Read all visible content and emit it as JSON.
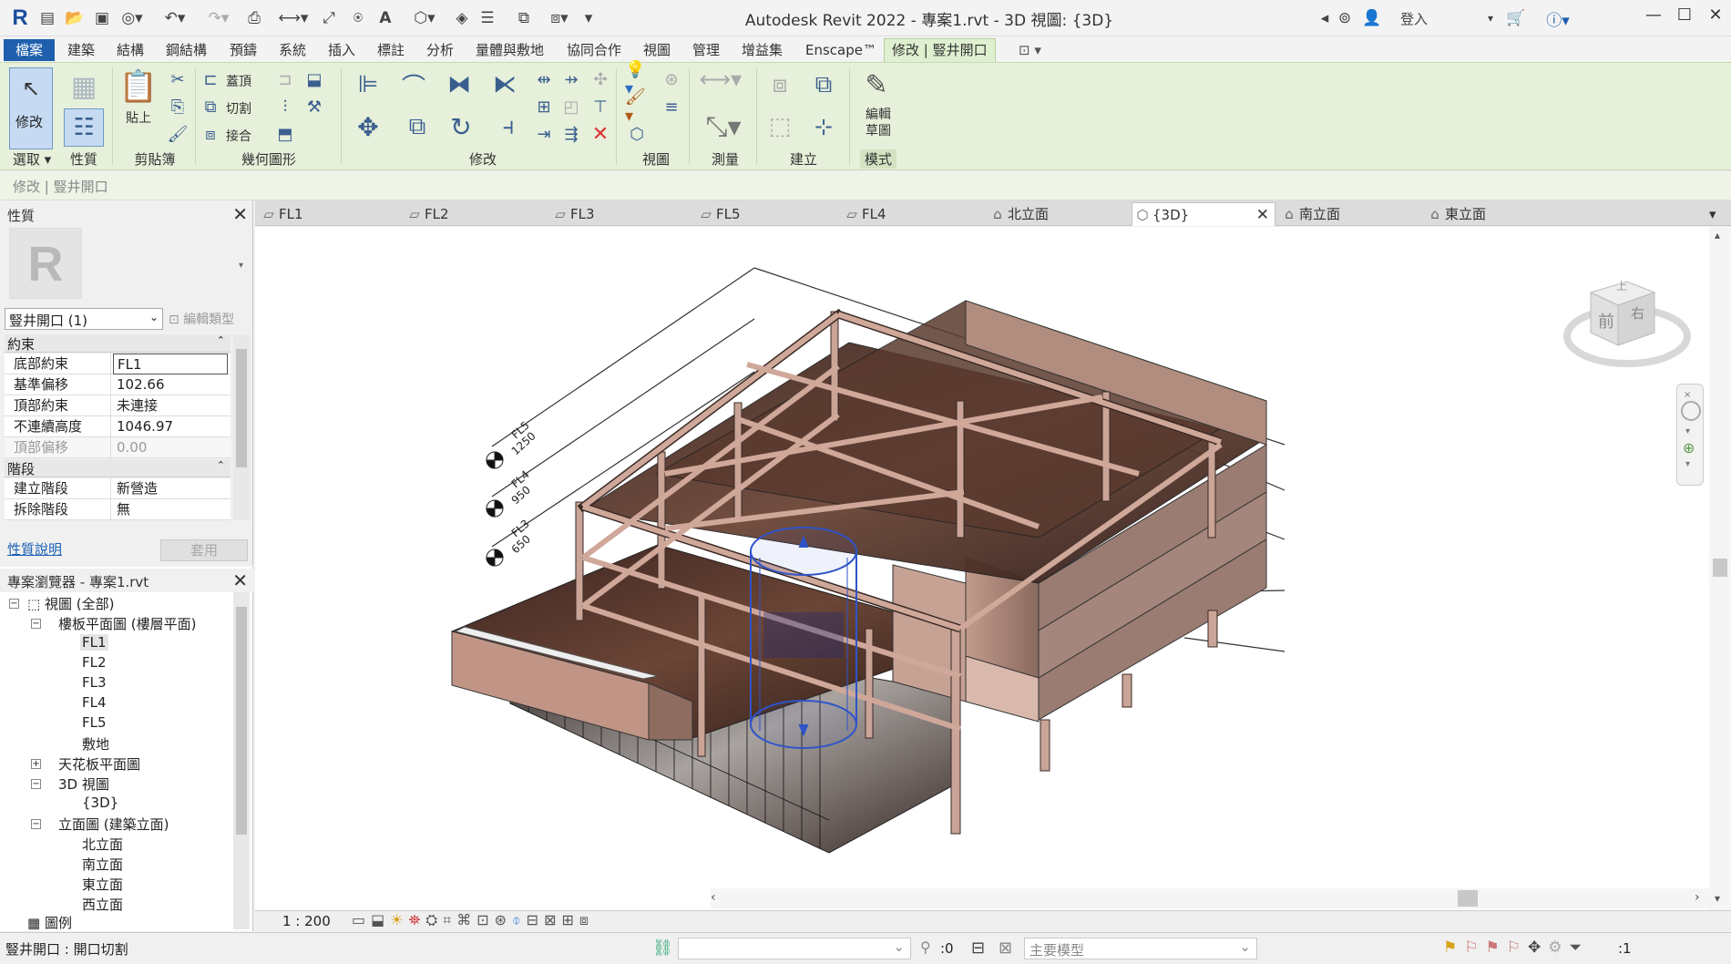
{
  "app": {
    "logo": "R",
    "title": "Autodesk Revit 2022 - 專案1.rvt - 3D 視圖: {3D}",
    "login": "登入"
  },
  "ribbon_tabs": [
    "檔案",
    "建築",
    "結構",
    "鋼結構",
    "預鑄",
    "系統",
    "插入",
    "標註",
    "分析",
    "量體與敷地",
    "協同合作",
    "視圖",
    "管理",
    "增益集",
    "Enscape™",
    "修改 | 豎井開口"
  ],
  "ribbon": {
    "modify_label": "修改",
    "paste_label": "貼上",
    "cope_label": "蓋頂",
    "cut_label": "切割",
    "join_label": "接合",
    "edit_sketch_label": "編輯\n草圖",
    "groups": [
      "選取",
      "性質",
      "剪貼簿",
      "幾何圖形",
      "修改",
      "視圖",
      "測量",
      "建立",
      "模式"
    ]
  },
  "context_bar": "修改 | 豎井開口",
  "properties": {
    "title": "性質",
    "type_select": "豎井開口 (1)",
    "edit_type": "編輯類型",
    "sections": [
      {
        "name": "約束",
        "rows": [
          {
            "key": "底部約束",
            "value": "FL1"
          },
          {
            "key": "基準偏移",
            "value": "102.66"
          },
          {
            "key": "頂部約束",
            "value": "未連接"
          },
          {
            "key": "不連續高度",
            "value": "1046.97"
          },
          {
            "key": "頂部偏移",
            "value": "0.00"
          }
        ]
      },
      {
        "name": "階段",
        "rows": [
          {
            "key": "建立階段",
            "value": "新營造"
          },
          {
            "key": "拆除階段",
            "value": "無"
          }
        ]
      }
    ],
    "help": "性質說明",
    "apply": "套用"
  },
  "browser": {
    "title": "專案瀏覽器 - 專案1.rvt",
    "views_all": "視圖 (全部)",
    "floor_plans": "樓板平面圖 (樓層平面)",
    "floor_items": [
      "FL1",
      "FL2",
      "FL3",
      "FL4",
      "FL5",
      "敷地"
    ],
    "ceiling_plans": "天花板平面圖",
    "views_3d": "3D 視圖",
    "view_3d_item": "{3D}",
    "elevations": "立面圖 (建築立面)",
    "elevation_items": [
      "北立面",
      "南立面",
      "東立面",
      "西立面"
    ],
    "legends": "圖例"
  },
  "view_tabs": [
    {
      "label": "FL1",
      "icon": "plan-icon"
    },
    {
      "label": "FL2",
      "icon": "plan-icon"
    },
    {
      "label": "FL3",
      "icon": "plan-icon"
    },
    {
      "label": "FL5",
      "icon": "plan-icon"
    },
    {
      "label": "FL4",
      "icon": "plan-icon"
    },
    {
      "label": "北立面",
      "icon": "elevation-icon"
    },
    {
      "label": "{3D}",
      "icon": "3d-icon"
    },
    {
      "label": "南立面",
      "icon": "elevation-icon"
    },
    {
      "label": "東立面",
      "icon": "elevation-icon"
    }
  ],
  "levels": [
    {
      "name": "FL5",
      "elev": "1250"
    },
    {
      "name": "FL4",
      "elev": "950"
    },
    {
      "name": "FL3",
      "elev": "650"
    }
  ],
  "viewcube": {
    "front": "前",
    "right": "右",
    "top": "上"
  },
  "view_control": {
    "scale": "1 : 200"
  },
  "status": {
    "text": "豎井開口 : 開口切割",
    "count": ":0",
    "model": "主要模型",
    "filter": ":1"
  },
  "colors": {
    "file_tab": "#1f5fae",
    "ribbon_bg": "#e6f0da",
    "slab": "#5a3a2f",
    "wall": "#b08878",
    "frame": "#c9a497",
    "shaft": "#2e54c8"
  }
}
